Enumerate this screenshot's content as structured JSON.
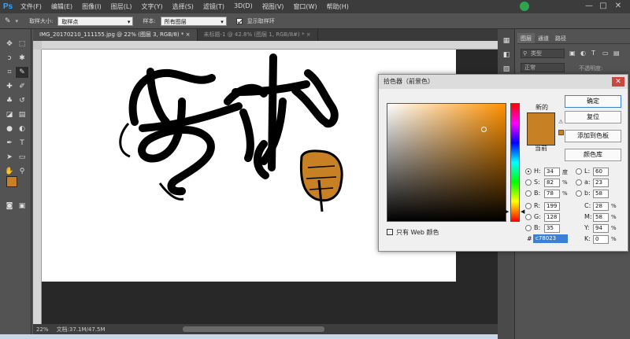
{
  "app": {
    "logo": "Ps"
  },
  "menu": [
    "文件(F)",
    "编辑(E)",
    "图像(I)",
    "图层(L)",
    "文字(Y)",
    "选择(S)",
    "滤镜(T)",
    "3D(D)",
    "视图(V)",
    "窗口(W)",
    "帮助(H)"
  ],
  "options": {
    "sample_size_label": "取样大小:",
    "sample_size_value": "取样点",
    "sample_label": "样本:",
    "sample_value": "所有图层",
    "show_ring_label": "显示取样环"
  },
  "tabs": [
    {
      "label": "IMG_20170210_111155.jpg @ 22% (图层 3, RGB/8) *"
    },
    {
      "label": "未标题-1 @ 42.8% (图层 1, RGB/8#) *"
    }
  ],
  "status": {
    "zoom": "22%",
    "doc": "文档:37.1M/47.5M"
  },
  "right_panel": {
    "tabs": [
      "图层",
      "通道",
      "路径"
    ],
    "filter_placeholder": "类型",
    "blend": "正常",
    "opacity_label": "不透明度:"
  },
  "picker": {
    "title": "拾色器（前景色）",
    "new_label": "新的",
    "current_label": "当前",
    "buttons": {
      "ok": "确定",
      "reset": "复位",
      "add_swatch": "添加到色板",
      "library": "颜色库"
    },
    "web_only_label": "只有 Web 颜色",
    "hsb": {
      "h": "34",
      "h_unit": "度",
      "s": "82",
      "s_unit": "%",
      "b": "78",
      "b_unit": "%"
    },
    "rgb": {
      "r": "199",
      "g": "128",
      "b": "35"
    },
    "lab": {
      "l": "60",
      "a": "23",
      "b": "58"
    },
    "cmyk": {
      "c": "28",
      "m": "58",
      "y": "94",
      "k": "0"
    },
    "pct": "%",
    "hex_label": "#",
    "hex": "c78023"
  },
  "colors": {
    "foreground": "#c78023",
    "background": "#ffffff",
    "hue_base": "#ff9100"
  }
}
